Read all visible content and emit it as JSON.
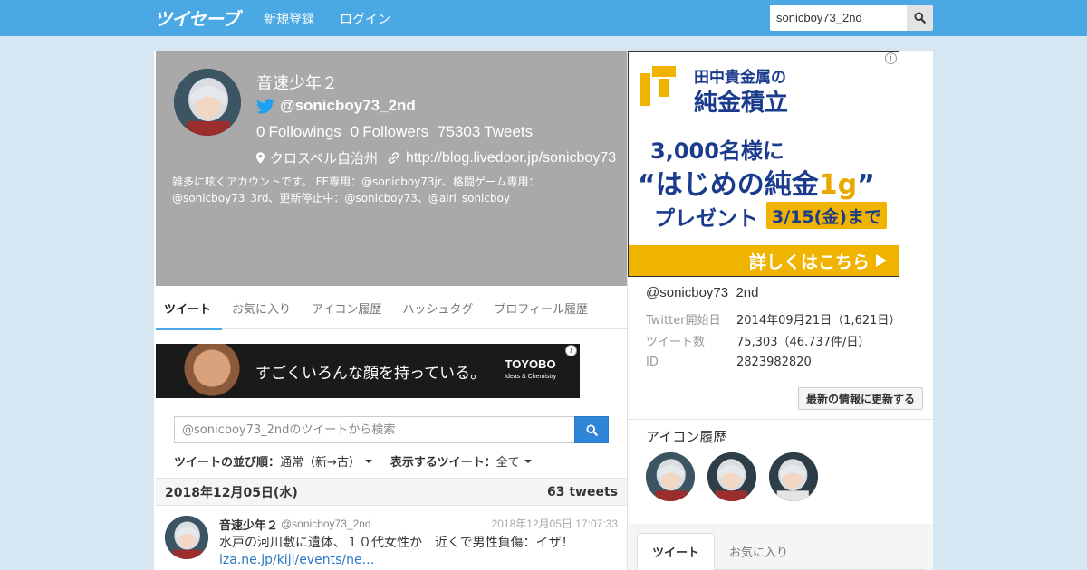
{
  "navbar": {
    "logo": "ツイセーブ",
    "signup": "新規登録",
    "login": "ログイン",
    "search_value": "sonicboy73_2nd"
  },
  "profile": {
    "name": "音速少年２",
    "handle": "@sonicboy73_2nd",
    "followings_count": "0",
    "followings_label": "Followings",
    "followers_count": "0",
    "followers_label": "Followers",
    "tweets_count": "75303",
    "tweets_label": "Tweets",
    "location": "クロスベル自治州",
    "url": "http://blog.livedoor.jp/sonicboy73",
    "bio": "雑多に呟くアカウントです。 FE専用：@sonicboy73jr、格闘ゲーム専用：@sonicboy73_3rd、更新停止中：@sonicboy73、@airi_sonicboy"
  },
  "tabs": [
    "ツイート",
    "お気に入り",
    "アイコン履歴",
    "ハッシュタグ",
    "プロフィール履歴"
  ],
  "ad_left": {
    "copy": "すごくいろんな顔を持っている。",
    "brand": "TOYOBO",
    "brand_sub": "Ideas & Chemistry"
  },
  "tweet_search": {
    "placeholder": "@sonicboy73_2ndのツイートから検索"
  },
  "sort": {
    "order_label": "ツイートの並び順：",
    "order_value": "通常（新→古）",
    "show_label": "表示するツイート：",
    "show_value": "全て"
  },
  "date_row": {
    "date": "2018年12月05日(水)",
    "count": "63 tweets"
  },
  "tweet": {
    "name": "音速少年２",
    "handle": "@sonicboy73_2nd",
    "time": "2018年12月05日 17:07:33",
    "text": "水戸の河川敷に遺体、１０代女性か　近くで男性負傷：イザ！ ",
    "link": "iza.ne.jp/kiji/events/ne…"
  },
  "ad_right": {
    "company_line1": "田中貴金属の",
    "company_line2": "純金積立",
    "line1": "3,000名様に",
    "line2_a": "“はじめの純金",
    "line2_b": "1g",
    "line2_c": "”",
    "line3": "プレゼント",
    "tag": "3/15(金)まで",
    "cta": "詳しくはこちら"
  },
  "right_info": {
    "handle": "@sonicboy73_2nd",
    "rows": [
      {
        "k": "Twitter開始日",
        "v": "2014年09月21日（1,621日）"
      },
      {
        "k": "ツイート数",
        "v": "75,303（46.737件/日）"
      },
      {
        "k": "ID",
        "v": "2823982820"
      }
    ],
    "refresh": "最新の情報に更新する",
    "icons_title": "アイコン履歴"
  },
  "right_tabs": [
    "ツイート",
    "お気に入り"
  ],
  "colors": {
    "navbar": "#4aa9e4",
    "profile_bg": "#a9a9a9",
    "accent": "#4aa9e4",
    "search_btn": "#2f86d8",
    "ad_gold": "#f0b400",
    "ad_navy": "#1b3b8c"
  }
}
